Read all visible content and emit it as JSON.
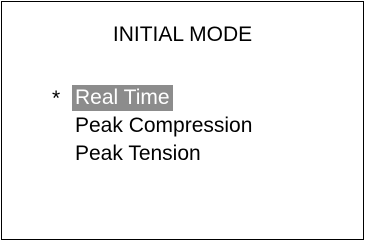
{
  "screen": {
    "title": "INITIAL MODE",
    "cursor_symbol": "*",
    "selected_index": 0,
    "colors": {
      "background": "#ffffff",
      "text": "#000000",
      "highlight_bg": "#8c8c8c",
      "highlight_text": "#ffffff"
    },
    "options": [
      {
        "label": "Real Time"
      },
      {
        "label": "Peak Compression"
      },
      {
        "label": "Peak Tension"
      }
    ]
  }
}
